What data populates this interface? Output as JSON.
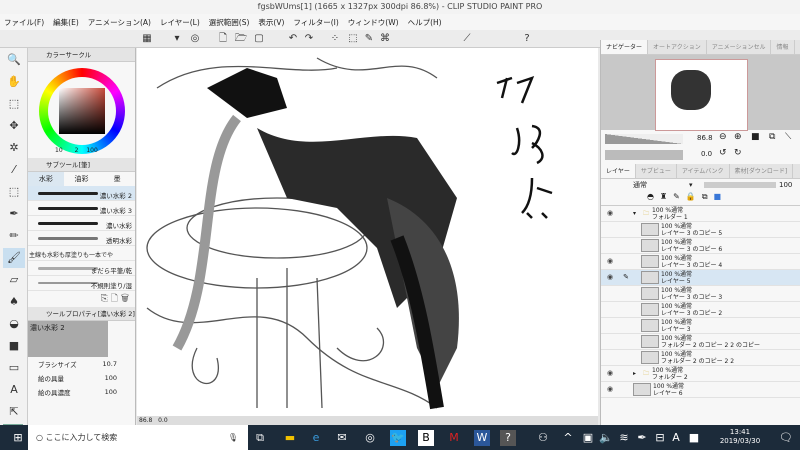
{
  "window": {
    "title": "fgsbWUms[1] (1665 x 1327px 300dpi 86.8%) - CLIP STUDIO PAINT PRO"
  },
  "menu": [
    "ファイル(F)",
    "編集(E)",
    "アニメーション(A)",
    "レイヤー(L)",
    "選択範囲(S)",
    "表示(V)",
    "フィルター(I)",
    "ウィンドウ(W)",
    "ヘルプ(H)"
  ],
  "color_panel": {
    "title": "カラーサークル",
    "values": [
      "10",
      "2",
      "100"
    ],
    "accent": "#c84a3a"
  },
  "subtool_panel": {
    "title": "サブツール[筆]",
    "tabs": [
      "水彩",
      "油彩",
      "墨"
    ],
    "brushes": [
      "濃い水彩 2",
      "濃い水彩 3",
      "濃い水彩",
      "透明水彩",
      "主線も水彩も厚塗りも一本でや",
      "まだら平筆/乾",
      "不規則塗り/湿"
    ]
  },
  "tool_property": {
    "title": "ツールプロパティ[濃い水彩 2]",
    "brush_name": "濃い水彩 2",
    "props": [
      {
        "label": "ブラシサイズ",
        "value": "10.7"
      },
      {
        "label": "絵の具量",
        "value": "100"
      },
      {
        "label": "絵の具濃度",
        "value": "100"
      }
    ]
  },
  "navigator": {
    "tabs": [
      "ナビゲーター",
      "オートアクション",
      "アニメーションセル",
      "情報"
    ],
    "zoom": "86.8",
    "rotation": "0.0"
  },
  "layer_panel": {
    "tabs": [
      "レイヤー",
      "サブビュー",
      "アイテムバンク",
      "素材[ダウンロード]"
    ],
    "blend": "通常",
    "opacity": "100",
    "layers": [
      {
        "mode": "100 %通常",
        "name": "フォルダー 1",
        "eye": true,
        "folder": true,
        "open": true
      },
      {
        "mode": "100 %通常",
        "name": "レイヤー 3 のコピー 5",
        "eye": false
      },
      {
        "mode": "100 %通常",
        "name": "レイヤー 3 のコピー 6",
        "eye": false
      },
      {
        "mode": "100 %通常",
        "name": "レイヤー 3 のコピー 4",
        "eye": true
      },
      {
        "mode": "100 %通常",
        "name": "レイヤー 5",
        "eye": true,
        "selected": true
      },
      {
        "mode": "100 %通常",
        "name": "レイヤー 3 のコピー 3",
        "eye": false
      },
      {
        "mode": "100 %通常",
        "name": "レイヤー 3 のコピー 2",
        "eye": false
      },
      {
        "mode": "100 %通常",
        "name": "レイヤー 3",
        "eye": false
      },
      {
        "mode": "100 %通常",
        "name": "フォルダー 2 のコピー 2 2 のコピー",
        "eye": false
      },
      {
        "mode": "100 %通常",
        "name": "フォルダー 2 のコピー 2 2",
        "eye": false
      },
      {
        "mode": "100 %通常",
        "name": "フォルダー 2",
        "eye": true,
        "folder": true
      },
      {
        "mode": "100 %通常",
        "name": "レイヤー 6",
        "eye": true
      }
    ]
  },
  "canvas": {
    "zoom": "86.8",
    "angle": "0.0"
  },
  "taskbar": {
    "search_placeholder": "ここに入力して検索",
    "time": "13:41",
    "date": "2019/03/30"
  }
}
